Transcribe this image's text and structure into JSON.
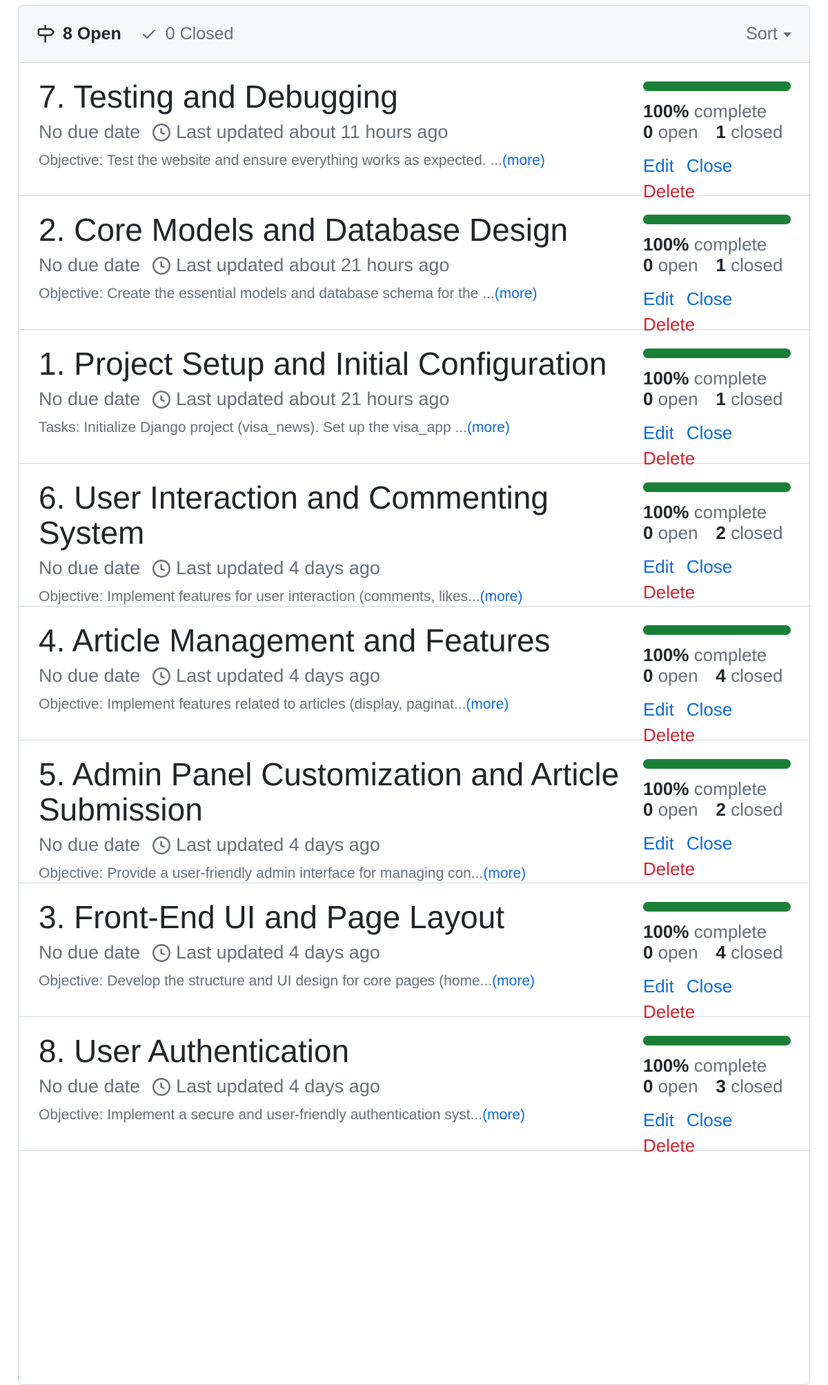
{
  "header": {
    "open_label": "8 Open",
    "closed_label": "0 Closed",
    "sort_label": "Sort"
  },
  "colors": {
    "progress": "#1a7f37",
    "link": "#0969da",
    "danger": "#cf222e"
  },
  "milestones": [
    {
      "title": "7. Testing and Debugging",
      "due": "No due date",
      "updated": "Last updated about 11 hours ago",
      "desc": "Objective: Test the website and ensure everything works as expected. ...",
      "more": "(more)",
      "percent": "100%",
      "complete_label": "complete",
      "open_count": "0",
      "open_label": "open",
      "closed_count": "1",
      "closed_label": "closed",
      "progress_fraction": 1.0,
      "edit": "Edit",
      "close": "Close",
      "delete": "Delete"
    },
    {
      "title": "2. Core Models and Database Design",
      "due": "No due date",
      "updated": "Last updated about 21 hours ago",
      "desc": "Objective: Create the essential models and database schema for the ...",
      "more": "(more)",
      "percent": "100%",
      "complete_label": "complete",
      "open_count": "0",
      "open_label": "open",
      "closed_count": "1",
      "closed_label": "closed",
      "progress_fraction": 1.0,
      "edit": "Edit",
      "close": "Close",
      "delete": "Delete"
    },
    {
      "title": "1. Project Setup and Initial Configuration",
      "due": "No due date",
      "updated": "Last updated about 21 hours ago",
      "desc": "Tasks: Initialize Django project (visa_news). Set up the visa_app ...",
      "more": "(more)",
      "percent": "100%",
      "complete_label": "complete",
      "open_count": "0",
      "open_label": "open",
      "closed_count": "1",
      "closed_label": "closed",
      "progress_fraction": 1.0,
      "edit": "Edit",
      "close": "Close",
      "delete": "Delete"
    },
    {
      "title": "6. User Interaction and Commenting System",
      "due": "No due date",
      "updated": "Last updated 4 days ago",
      "desc": "Objective: Implement features for user interaction (comments, likes...",
      "more": "(more)",
      "percent": "100%",
      "complete_label": "complete",
      "open_count": "0",
      "open_label": "open",
      "closed_count": "2",
      "closed_label": "closed",
      "progress_fraction": 1.0,
      "edit": "Edit",
      "close": "Close",
      "delete": "Delete"
    },
    {
      "title": "4. Article Management and Features",
      "due": "No due date",
      "updated": "Last updated 4 days ago",
      "desc": "Objective: Implement features related to articles (display, paginat...",
      "more": "(more)",
      "percent": "100%",
      "complete_label": "complete",
      "open_count": "0",
      "open_label": "open",
      "closed_count": "4",
      "closed_label": "closed",
      "progress_fraction": 1.0,
      "edit": "Edit",
      "close": "Close",
      "delete": "Delete"
    },
    {
      "title": "5. Admin Panel Customization and Article Submission",
      "due": "No due date",
      "updated": "Last updated 4 days ago",
      "desc": "Objective: Provide a user-friendly admin interface for managing con...",
      "more": "(more)",
      "percent": "100%",
      "complete_label": "complete",
      "open_count": "0",
      "open_label": "open",
      "closed_count": "2",
      "closed_label": "closed",
      "progress_fraction": 1.0,
      "edit": "Edit",
      "close": "Close",
      "delete": "Delete"
    },
    {
      "title": "3. Front-End UI and Page Layout",
      "due": "No due date",
      "updated": "Last updated 4 days ago",
      "desc": "Objective: Develop the structure and UI design for core pages (home...",
      "more": "(more)",
      "percent": "100%",
      "complete_label": "complete",
      "open_count": "0",
      "open_label": "open",
      "closed_count": "4",
      "closed_label": "closed",
      "progress_fraction": 1.0,
      "edit": "Edit",
      "close": "Close",
      "delete": "Delete"
    },
    {
      "title": "8. User Authentication",
      "due": "No due date",
      "updated": "Last updated 4 days ago",
      "desc": "Objective: Implement a secure and user-friendly authentication syst...",
      "more": "(more)",
      "percent": "100%",
      "complete_label": "complete",
      "open_count": "0",
      "open_label": "open",
      "closed_count": "3",
      "closed_label": "closed",
      "progress_fraction": 1.0,
      "edit": "Edit",
      "close": "Close",
      "delete": "Delete"
    }
  ]
}
